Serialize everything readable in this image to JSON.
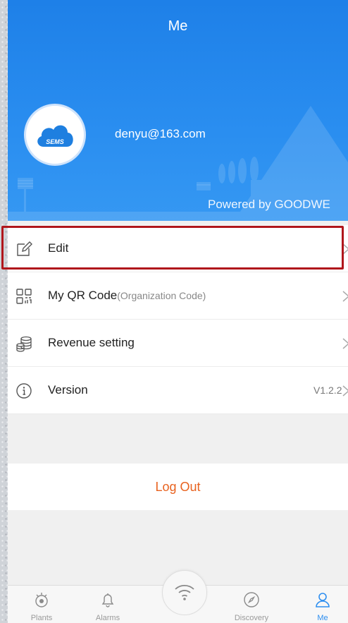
{
  "header": {
    "title": "Me",
    "email": "denyu@163.com",
    "powered_by": "Powered by GOODWE",
    "avatar_logo_text": "SEMS"
  },
  "menu": [
    {
      "label": "Edit",
      "icon": "edit-icon"
    },
    {
      "label": "My QR Code",
      "sub": "(Organization Code)",
      "icon": "qr-code-icon"
    },
    {
      "label": "Revenue setting",
      "icon": "coins-icon"
    },
    {
      "label": "Version",
      "value": "V1.2.2",
      "icon": "info-icon"
    }
  ],
  "logout_label": "Log Out",
  "tabs": [
    {
      "label": "Plants",
      "icon": "plant-eye-icon",
      "active": false
    },
    {
      "label": "Alarms",
      "icon": "bell-icon",
      "active": false
    },
    {
      "label": "",
      "icon": "wifi-icon",
      "active": false
    },
    {
      "label": "Discovery",
      "icon": "compass-icon",
      "active": false
    },
    {
      "label": "Me",
      "icon": "person-icon",
      "active": true
    }
  ],
  "colors": {
    "header_blue": "#2a8ef0",
    "logout_orange": "#e8621f",
    "active_tab": "#2f8ff0",
    "highlight_red": "#b0161c"
  }
}
